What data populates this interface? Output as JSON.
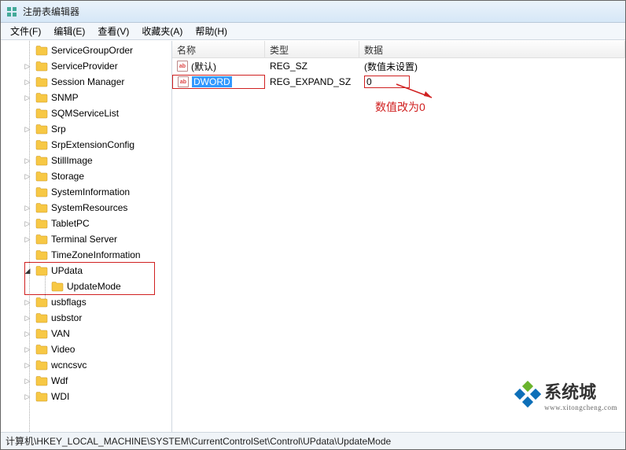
{
  "window": {
    "title": "注册表编辑器"
  },
  "menu": {
    "file": "文件(F)",
    "edit": "编辑(E)",
    "view": "查看(V)",
    "favorites": "收藏夹(A)",
    "help": "帮助(H)"
  },
  "tree": {
    "items": [
      {
        "label": "ServiceGroupOrder",
        "expander": ""
      },
      {
        "label": "ServiceProvider",
        "expander": "▷"
      },
      {
        "label": "Session Manager",
        "expander": "▷"
      },
      {
        "label": "SNMP",
        "expander": "▷"
      },
      {
        "label": "SQMServiceList",
        "expander": ""
      },
      {
        "label": "Srp",
        "expander": "▷"
      },
      {
        "label": "SrpExtensionConfig",
        "expander": ""
      },
      {
        "label": "StillImage",
        "expander": "▷"
      },
      {
        "label": "Storage",
        "expander": "▷"
      },
      {
        "label": "SystemInformation",
        "expander": ""
      },
      {
        "label": "SystemResources",
        "expander": "▷"
      },
      {
        "label": "TabletPC",
        "expander": "▷"
      },
      {
        "label": "Terminal Server",
        "expander": "▷"
      },
      {
        "label": "TimeZoneInformation",
        "expander": ""
      },
      {
        "label": "UPdata",
        "expander": "◢",
        "expanded": true,
        "highlight": true
      },
      {
        "label": "UpdateMode",
        "expander": "",
        "child": true,
        "highlight": true
      },
      {
        "label": "usbflags",
        "expander": "▷"
      },
      {
        "label": "usbstor",
        "expander": "▷"
      },
      {
        "label": "VAN",
        "expander": "▷"
      },
      {
        "label": "Video",
        "expander": "▷"
      },
      {
        "label": "wcncsvc",
        "expander": "▷"
      },
      {
        "label": "Wdf",
        "expander": "▷"
      },
      {
        "label": "WDI",
        "expander": "▷"
      }
    ]
  },
  "list": {
    "columns": {
      "name": "名称",
      "type": "类型",
      "data": "数据"
    },
    "rows": [
      {
        "name": "(默认)",
        "type": "REG_SZ",
        "data": "(数值未设置)",
        "editing": false
      },
      {
        "name": "DWORD",
        "type": "REG_EXPAND_SZ",
        "data": "0",
        "editing": true,
        "data_highlight": true
      }
    ]
  },
  "annotation": {
    "text": "数值改为0"
  },
  "statusbar": {
    "path": "计算机\\HKEY_LOCAL_MACHINE\\SYSTEM\\CurrentControlSet\\Control\\UPdata\\UpdateMode"
  },
  "watermark": {
    "brand": "系统城",
    "url": "www.xitongcheng.com"
  }
}
